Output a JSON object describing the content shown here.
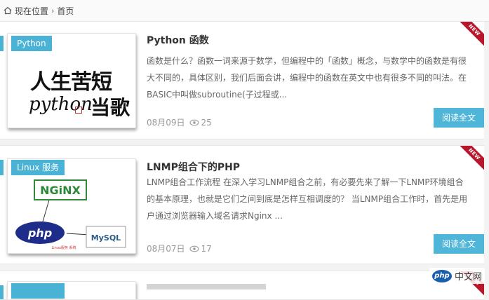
{
  "breadcrumb": {
    "location_label": "现在位置",
    "home_label": "首页"
  },
  "articles": [
    {
      "tag": "Python",
      "title": "Python 函数",
      "excerpt": "函数是什么？函数一词来源于数学，但编程中的「函数」概念，与数学中的函数是有很大不同的，具体区别，我们后面会讲，编程中的函数在英文中也有很多不同的叫法。在BASIC中叫做subroutine(子过程或...",
      "date": "08月09日",
      "views": "25",
      "read_more": "阅读全文",
      "ribbon": "NEW",
      "thumb_text": {
        "line1": "人生苦短",
        "line2": "python",
        "line2b": "当歌"
      }
    },
    {
      "tag": "Linux 服务",
      "title": "LNMP组合下的PHP",
      "excerpt": "LNMP组合工作流程 在深入学习LNMP组合之前，有必要先来了解一下LNMP环境组合的基本原理，也就是它们之间到底是怎样互相调度的？ 当LNMP组合工作时，首先是用户通过浏览器输入域名请求Nginx ...",
      "date": "08月07日",
      "views": "17",
      "read_more": "阅读全文",
      "ribbon": "NEW",
      "thumb_text": {
        "nginx": "NGiNX",
        "php": "php",
        "mysql": "MySQL",
        "caption": "Linux服务 系统"
      }
    },
    {
      "ribbon": "NEW"
    }
  ],
  "watermark": {
    "logo_text": "php",
    "site_name": "中文网"
  },
  "colors": {
    "accent": "#4ab3d5",
    "button": "#50b6d9",
    "ribbon": "#b8162a"
  }
}
